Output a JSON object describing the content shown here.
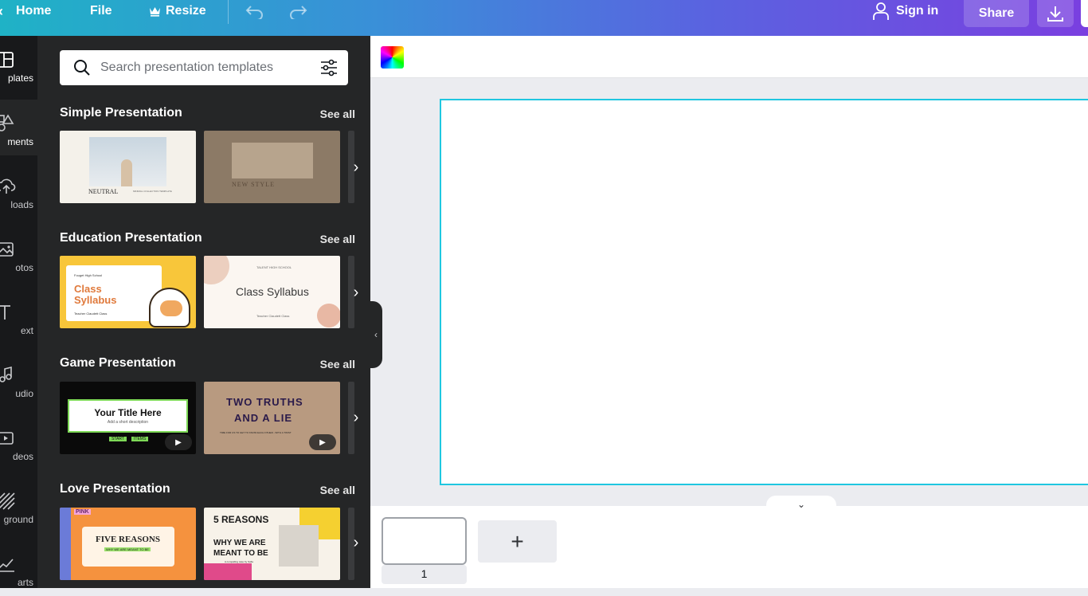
{
  "topbar": {
    "home": "Home",
    "file": "File",
    "resize": "Resize",
    "sign_in": "Sign in",
    "share": "Share"
  },
  "rail": {
    "items": [
      {
        "label": "plates",
        "icon": "templates-icon"
      },
      {
        "label": "ments",
        "icon": "elements-icon"
      },
      {
        "label": "loads",
        "icon": "uploads-icon"
      },
      {
        "label": "otos",
        "icon": "photos-icon"
      },
      {
        "label": "ext",
        "icon": "text-icon"
      },
      {
        "label": "udio",
        "icon": "audio-icon"
      },
      {
        "label": "deos",
        "icon": "videos-icon"
      },
      {
        "label": "ground",
        "icon": "background-icon"
      },
      {
        "label": "arts",
        "icon": "charts-icon"
      }
    ]
  },
  "panel": {
    "search_placeholder": "Search presentation templates",
    "see_all": "See all",
    "sections": [
      {
        "title": "Simple Presentation",
        "templates": [
          {
            "text": "NEUTRAL",
            "subtext": "MINIMAL COLLECTION TEMPLATE"
          },
          {
            "text": "NEW STYLE"
          }
        ]
      },
      {
        "title": "Education Presentation",
        "templates": [
          {
            "school": "Fouget High School",
            "line1": "Class",
            "line2": "Syllabus",
            "teacher": "Teacher Claudett Class"
          },
          {
            "school": "TALENT HIGH SCHOOL",
            "text": "Class Syllabus",
            "teacher": "Teacher Claudett Class"
          }
        ]
      },
      {
        "title": "Game Presentation",
        "templates": [
          {
            "text": "Your Title Here",
            "subtext": "Add a short description",
            "btn1": "START",
            "btn2": "ITEMS"
          },
          {
            "line1": "TWO TRUTHS",
            "line2": "AND A LIE",
            "subtext": "TIME FOR US TO GET TO KNOW EACH OTHER - WITH A TWIST"
          }
        ]
      },
      {
        "title": "Love Presentation",
        "templates": [
          {
            "text": "FIVE REASONS",
            "subtext": "WHY WE ARE MEANT TO BE",
            "tag": "PINK"
          },
          {
            "line1": "5 REASONS",
            "line2": "WHY WE ARE",
            "line3": "MEANT TO BE",
            "subtext": "A compelling case by Sofia"
          }
        ]
      }
    ]
  },
  "bottom": {
    "page_number": "1",
    "add_page": "+"
  },
  "colors": {
    "accent": "#1fc7e0",
    "panel_bg": "#252627",
    "rail_bg": "#18191b"
  }
}
